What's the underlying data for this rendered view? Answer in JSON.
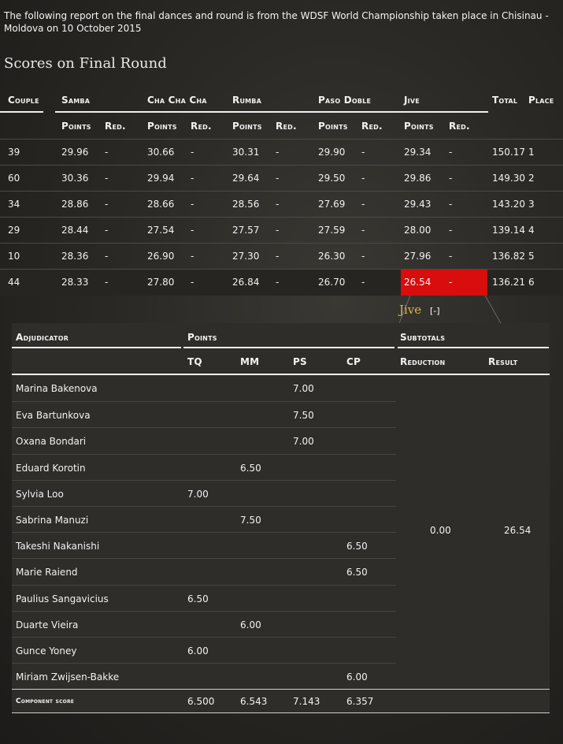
{
  "intro": "The following report on the final dances and round is from the WDSF World Championship taken place in Chisinau - Moldova on 10 October 2015",
  "section_title": "Scores on Final Round",
  "final_table": {
    "headers": {
      "couple": "Couple",
      "dances": [
        "Samba",
        "Cha Cha Cha",
        "Rumba",
        "Paso Doble",
        "Jive"
      ],
      "total": "Total",
      "place": "Place",
      "points": "Points",
      "red": "Red."
    },
    "rows": [
      {
        "couple": "39",
        "scores": [
          "29.96",
          "-",
          "30.66",
          "-",
          "30.31",
          "-",
          "29.90",
          "-",
          "29.34",
          "-"
        ],
        "total": "150.17",
        "place": "1"
      },
      {
        "couple": "60",
        "scores": [
          "30.36",
          "-",
          "29.94",
          "-",
          "29.64",
          "-",
          "29.50",
          "-",
          "29.86",
          "-"
        ],
        "total": "149.30",
        "place": "2"
      },
      {
        "couple": "34",
        "scores": [
          "28.86",
          "-",
          "28.66",
          "-",
          "28.56",
          "-",
          "27.69",
          "-",
          "29.43",
          "-"
        ],
        "total": "143.20",
        "place": "3"
      },
      {
        "couple": "29",
        "scores": [
          "28.44",
          "-",
          "27.54",
          "-",
          "27.57",
          "-",
          "27.59",
          "-",
          "28.00",
          "-"
        ],
        "total": "139.14",
        "place": "4"
      },
      {
        "couple": "10",
        "scores": [
          "28.36",
          "-",
          "26.90",
          "-",
          "27.30",
          "-",
          "26.30",
          "-",
          "27.96",
          "-"
        ],
        "total": "136.82",
        "place": "5"
      },
      {
        "couple": "44",
        "scores": [
          "28.33",
          "-",
          "27.80",
          "-",
          "26.84",
          "-",
          "26.70",
          "-",
          "26.54",
          "-"
        ],
        "total": "136.21",
        "place": "6"
      }
    ],
    "highlight_color": "#d80d0d"
  },
  "jive_panel": {
    "title": "Jive",
    "toggle": "[-]",
    "headers": {
      "adjudicator": "Adjudicator",
      "points": "Points",
      "subtotals": "Subtotals",
      "tq": "TQ",
      "mm": "MM",
      "ps": "PS",
      "cp": "CP",
      "reduction": "Reduction",
      "result": "Result"
    },
    "rows": [
      {
        "name": "Marina Bakenova",
        "tq": "",
        "mm": "",
        "ps": "7.00",
        "cp": ""
      },
      {
        "name": "Eva Bartunkova",
        "tq": "",
        "mm": "",
        "ps": "7.50",
        "cp": ""
      },
      {
        "name": "Oxana Bondari",
        "tq": "",
        "mm": "",
        "ps": "7.00",
        "cp": ""
      },
      {
        "name": "Eduard Korotin",
        "tq": "",
        "mm": "6.50",
        "ps": "",
        "cp": ""
      },
      {
        "name": "Sylvia Loo",
        "tq": "7.00",
        "mm": "",
        "ps": "",
        "cp": ""
      },
      {
        "name": "Sabrina Manuzi",
        "tq": "",
        "mm": "7.50",
        "ps": "",
        "cp": ""
      },
      {
        "name": "Takeshi Nakanishi",
        "tq": "",
        "mm": "",
        "ps": "",
        "cp": "6.50"
      },
      {
        "name": "Marie Raiend",
        "tq": "",
        "mm": "",
        "ps": "",
        "cp": "6.50"
      },
      {
        "name": "Paulius Sangavicius",
        "tq": "6.50",
        "mm": "",
        "ps": "",
        "cp": ""
      },
      {
        "name": "Duarte Vieira",
        "tq": "",
        "mm": "6.00",
        "ps": "",
        "cp": ""
      },
      {
        "name": "Gunce Yoney",
        "tq": "6.00",
        "mm": "",
        "ps": "",
        "cp": ""
      },
      {
        "name": "Miriam Zwijsen-Bakke",
        "tq": "",
        "mm": "",
        "ps": "",
        "cp": "6.00"
      }
    ],
    "reduction_value": "0.00",
    "result_value": "26.54",
    "component": {
      "label": "Component score",
      "tq": "6.500",
      "mm": "6.543",
      "ps": "7.143",
      "cp": "6.357"
    },
    "title_color": "#e2b24a"
  }
}
